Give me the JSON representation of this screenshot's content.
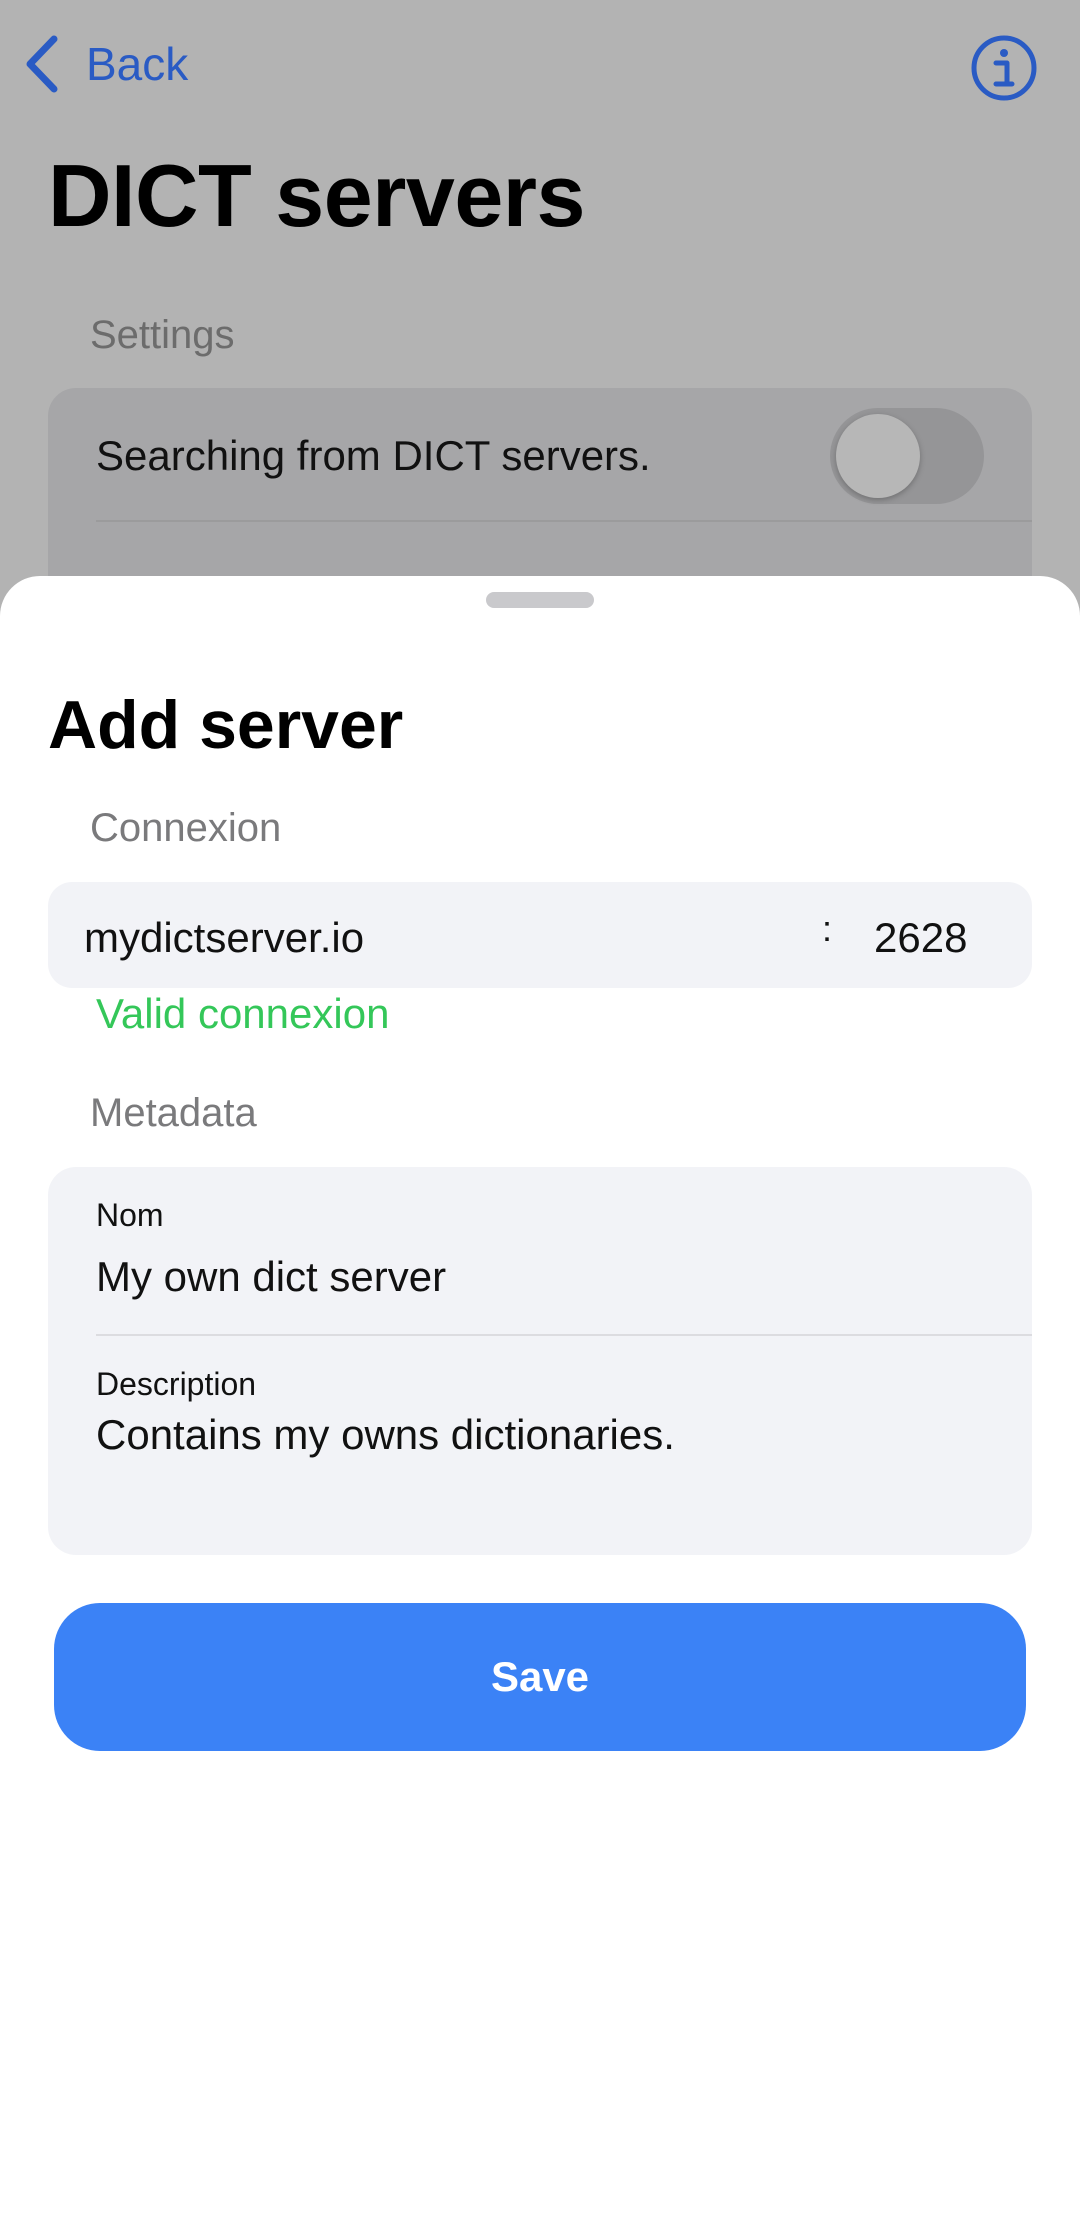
{
  "nav": {
    "back_label": "Back",
    "info_icon": "info-circle-icon"
  },
  "background_page": {
    "title": "DICT servers",
    "settings_header": "Settings",
    "search_toggle_label": "Searching from DICT servers.",
    "search_toggle_on": false
  },
  "sheet": {
    "title": "Add server",
    "connexion": {
      "header": "Connexion",
      "host": "mydictserver.io",
      "separator": ":",
      "port": "2628",
      "status": "Valid connexion"
    },
    "metadata": {
      "header": "Metadata",
      "name_label": "Nom",
      "name_value": "My own dict server",
      "description_label": "Description",
      "description_value": "Contains my owns dictionaries."
    },
    "save_label": "Save"
  },
  "colors": {
    "accent": "#3b82f6",
    "link": "#2a5bc4",
    "success": "#34c759"
  }
}
